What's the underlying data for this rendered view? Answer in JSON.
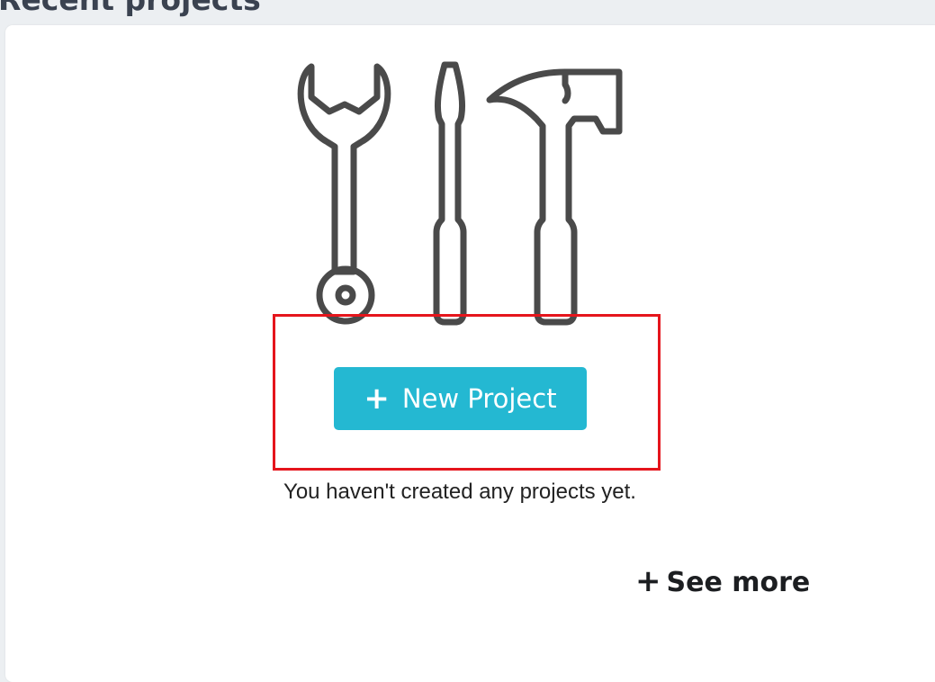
{
  "section": {
    "title": "Recent projects"
  },
  "empty_state": {
    "illustration_icon": "tools-icon",
    "new_project_label": "New Project",
    "new_project_icon": "plus-icon",
    "message": "You haven't created any projects yet."
  },
  "footer": {
    "see_more_label": "See more",
    "see_more_icon": "plus-icon"
  },
  "colors": {
    "button": "#24b8d2",
    "highlight": "#e5151c",
    "icon_stroke": "#4a4a4a"
  }
}
